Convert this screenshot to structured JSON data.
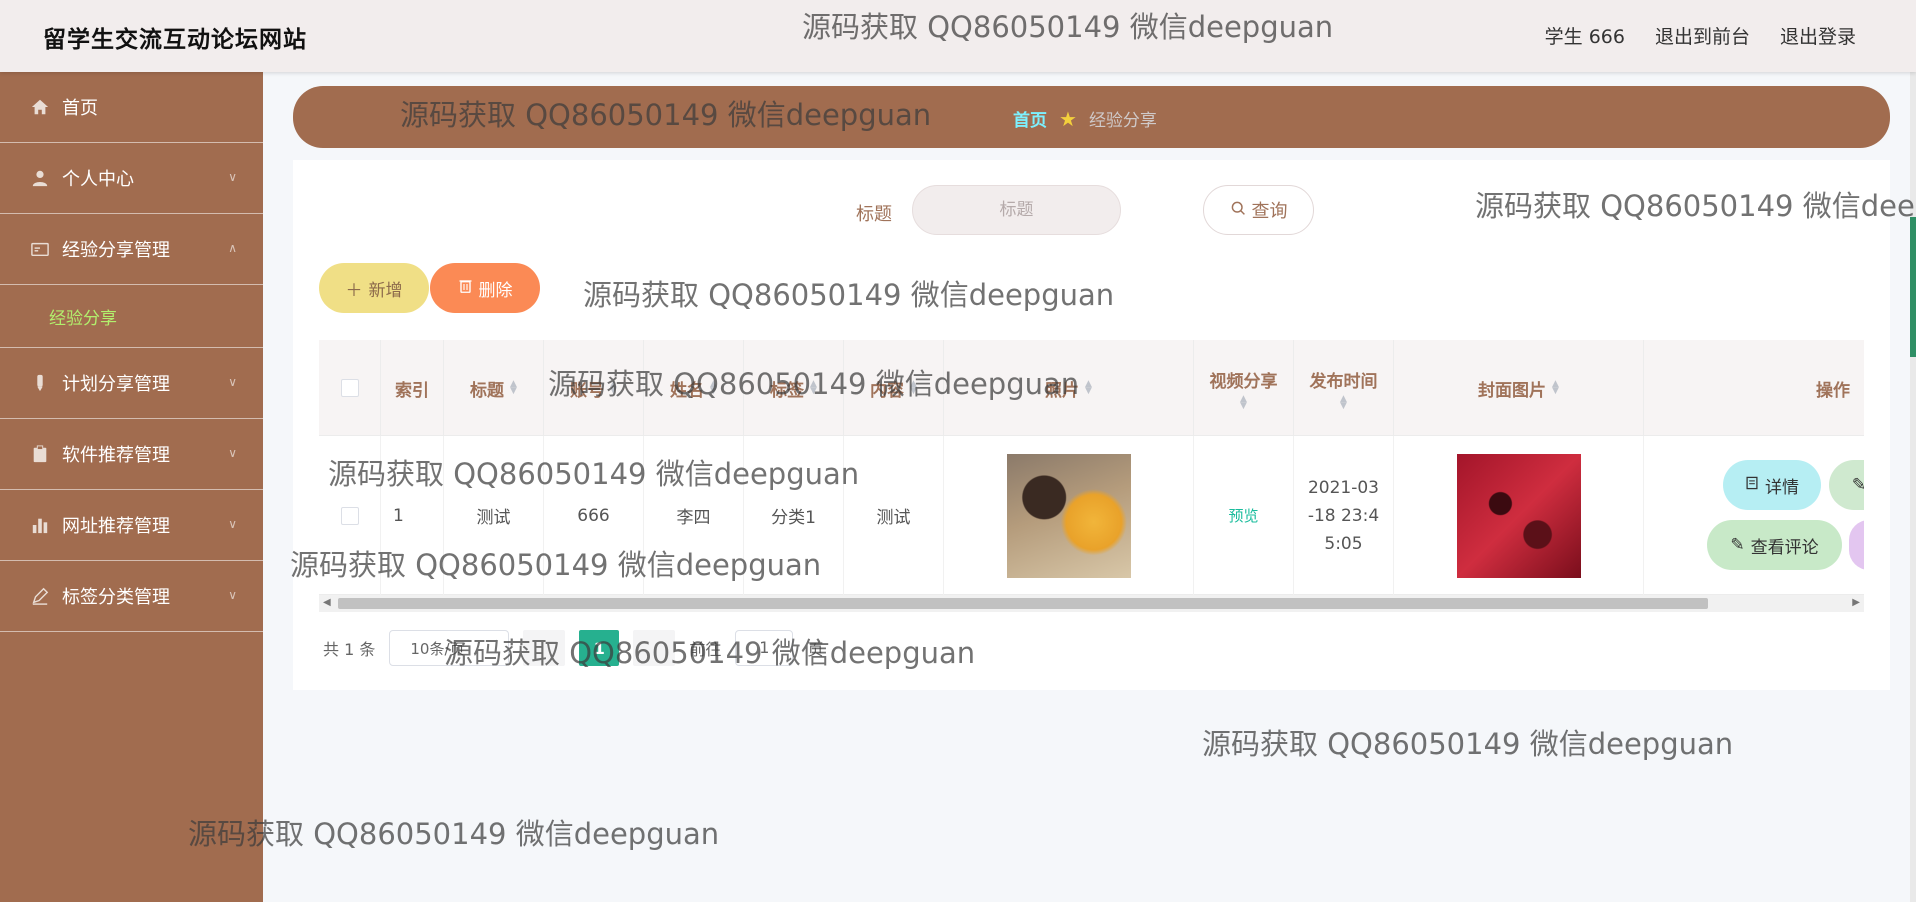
{
  "header": {
    "site_title": "留学生交流互动论坛网站",
    "user_label": "学生 666",
    "to_front": "退出到前台",
    "logout": "退出登录"
  },
  "sidebar": {
    "items": [
      {
        "label": "首页",
        "icon": "home-icon"
      },
      {
        "label": "个人中心",
        "icon": "user-icon"
      },
      {
        "label": "经验分享管理",
        "icon": "card-icon",
        "sub": "经验分享"
      },
      {
        "label": "计划分享管理",
        "icon": "pen-icon"
      },
      {
        "label": "软件推荐管理",
        "icon": "clipboard-icon"
      },
      {
        "label": "网址推荐管理",
        "icon": "bar-chart-icon"
      },
      {
        "label": "标签分类管理",
        "icon": "edit-icon"
      }
    ]
  },
  "breadcrumb": {
    "home": "首页",
    "current": "经验分享"
  },
  "search": {
    "label": "标题",
    "placeholder": "标题",
    "button": "查询"
  },
  "actions": {
    "add": "新增",
    "delete": "删除"
  },
  "table": {
    "headers": [
      "索引",
      "标题",
      "账号",
      "姓名",
      "标签",
      "内容",
      "照片",
      "视频分享",
      "发布时间",
      "封面图片",
      "操作"
    ],
    "row": {
      "index": "1",
      "title": "测试",
      "account": "666",
      "name": "李四",
      "tag": "分类1",
      "content": "测试",
      "video": "预览",
      "time_l1": "2021-03",
      "time_l2": "-18 23:4",
      "time_l3": "5:05",
      "ops": {
        "detail": "详情",
        "comment": "查看评论"
      }
    }
  },
  "pagination": {
    "total": "共 1 条",
    "page_size": "10条/页",
    "current_page": "1",
    "goto": "前往",
    "goto_value": "1",
    "page_unit": "页"
  },
  "watermark": "源码获取 QQ86050149 微信deepguan",
  "colors": {
    "sidebar": "#a16c4f",
    "accent": "#26b08f",
    "delete": "#fb8a55",
    "add": "#f0df86"
  }
}
